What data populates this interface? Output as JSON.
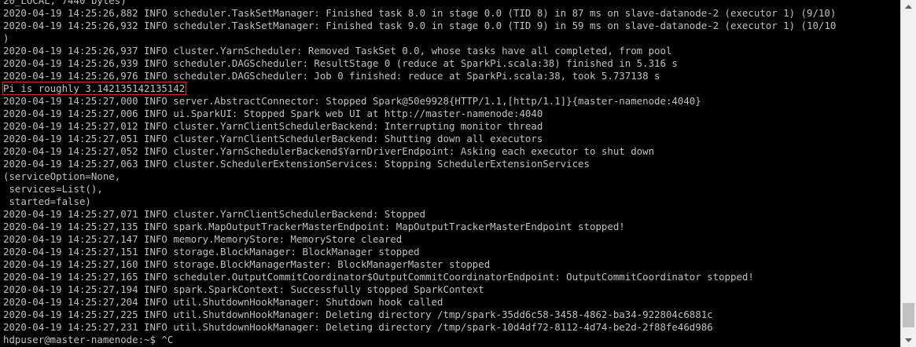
{
  "terminal": {
    "lines": [
      {
        "text": "20_LOCAL, 7440 bytes)"
      },
      {
        "text": "2020-04-19 14:25:26,882 INFO scheduler.TaskSetManager: Finished task 8.0 in stage 0.0 (TID 8) in 87 ms on slave-datanode-2 (executor 1) (9/10)"
      },
      {
        "text": "2020-04-19 14:25:26,932 INFO scheduler.TaskSetManager: Finished task 9.0 in stage 0.0 (TID 9) in 59 ms on slave-datanode-2 (executor 1) (10/10"
      },
      {
        "text": ")"
      },
      {
        "text": "2020-04-19 14:25:26,937 INFO cluster.YarnScheduler: Removed TaskSet 0.0, whose tasks have all completed, from pool"
      },
      {
        "text": "2020-04-19 14:25:26,939 INFO scheduler.DAGScheduler: ResultStage 0 (reduce at SparkPi.scala:38) finished in 5.316 s"
      },
      {
        "text": "2020-04-19 14:25:26,976 INFO scheduler.DAGScheduler: Job 0 finished: reduce at SparkPi.scala:38, took 5.737138 s"
      },
      {
        "text": "Pi is roughly 3.142135142135142",
        "highlighted": true
      },
      {
        "text": "2020-04-19 14:25:27,000 INFO server.AbstractConnector: Stopped Spark@50e9928{HTTP/1.1,[http/1.1]}{master-namenode:4040}"
      },
      {
        "text": "2020-04-19 14:25:27,006 INFO ui.SparkUI: Stopped Spark web UI at http://master-namenode:4040"
      },
      {
        "text": "2020-04-19 14:25:27,012 INFO cluster.YarnClientSchedulerBackend: Interrupting monitor thread"
      },
      {
        "text": "2020-04-19 14:25:27,051 INFO cluster.YarnClientSchedulerBackend: Shutting down all executors"
      },
      {
        "text": "2020-04-19 14:25:27,052 INFO cluster.YarnSchedulerBackend$YarnDriverEndpoint: Asking each executor to shut down"
      },
      {
        "text": "2020-04-19 14:25:27,063 INFO cluster.SchedulerExtensionServices: Stopping SchedulerExtensionServices"
      },
      {
        "text": "(serviceOption=None,"
      },
      {
        "text": " services=List(),"
      },
      {
        "text": " started=false)"
      },
      {
        "text": "2020-04-19 14:25:27,071 INFO cluster.YarnClientSchedulerBackend: Stopped"
      },
      {
        "text": "2020-04-19 14:25:27,135 INFO spark.MapOutputTrackerMasterEndpoint: MapOutputTrackerMasterEndpoint stopped!"
      },
      {
        "text": "2020-04-19 14:25:27,147 INFO memory.MemoryStore: MemoryStore cleared"
      },
      {
        "text": "2020-04-19 14:25:27,151 INFO storage.BlockManager: BlockManager stopped"
      },
      {
        "text": "2020-04-19 14:25:27,160 INFO storage.BlockManagerMaster: BlockManagerMaster stopped"
      },
      {
        "text": "2020-04-19 14:25:27,165 INFO scheduler.OutputCommitCoordinator$OutputCommitCoordinatorEndpoint: OutputCommitCoordinator stopped!"
      },
      {
        "text": "2020-04-19 14:25:27,194 INFO spark.SparkContext: Successfully stopped SparkContext"
      },
      {
        "text": "2020-04-19 14:25:27,204 INFO util.ShutdownHookManager: Shutdown hook called"
      },
      {
        "text": "2020-04-19 14:25:27,225 INFO util.ShutdownHookManager: Deleting directory /tmp/spark-35dd6c58-3458-4862-ba34-922804c6881c"
      },
      {
        "text": "2020-04-19 14:25:27,231 INFO util.ShutdownHookManager: Deleting directory /tmp/spark-10d4df72-8112-4d74-be2d-2f88fe46d986"
      },
      {
        "text": "hdpuser@master-namenode:~$ ^C",
        "prompt": true
      }
    ]
  },
  "colors": {
    "background": "#000000",
    "text": "#c0c0c0",
    "highlight_border": "#d62424",
    "scrollbar_track": "#f0f0f0",
    "scrollbar_thumb": "#c1c1c1"
  },
  "scrollbar": {
    "up_icon": "triangle-up-icon",
    "down_icon": "triangle-down-icon",
    "position_fraction": 0.97
  }
}
